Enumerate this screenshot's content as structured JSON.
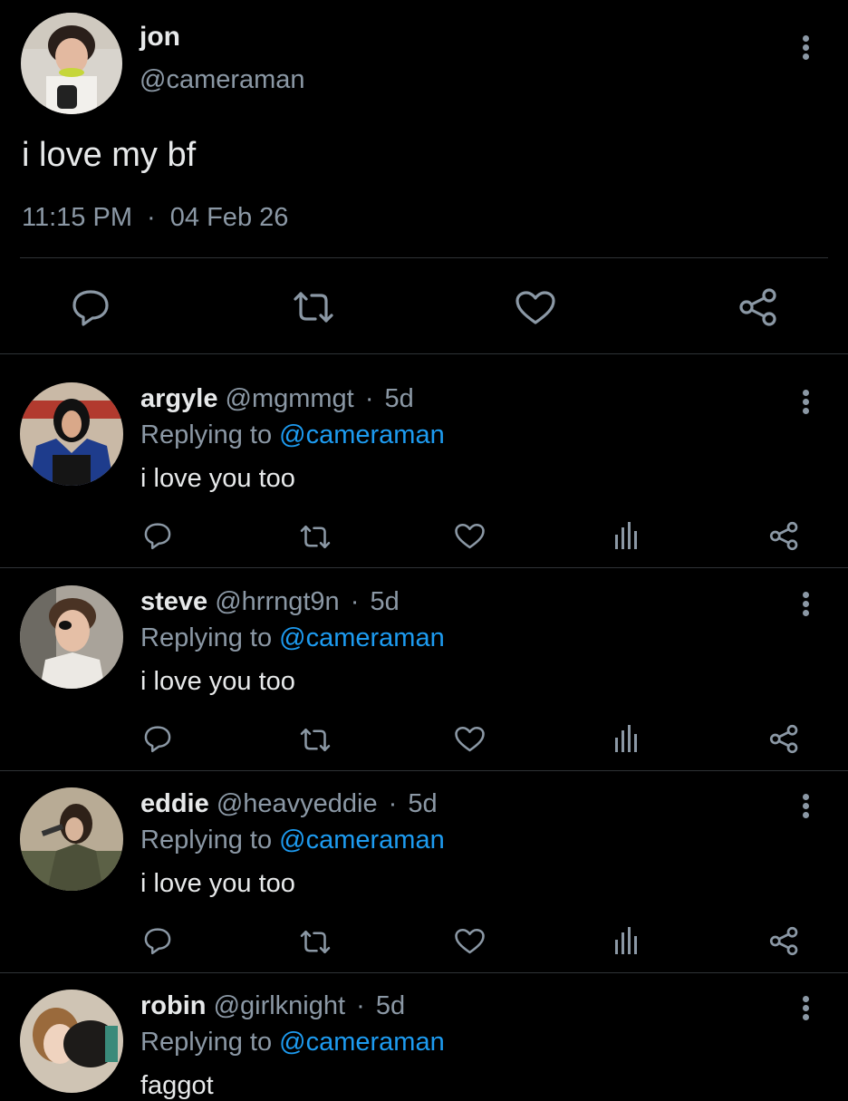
{
  "main_tweet": {
    "display_name": "jon",
    "handle": "@cameraman",
    "text": "i love my bf",
    "time": "11:15 PM",
    "sep": "·",
    "date": "04 Feb 26"
  },
  "replies": [
    {
      "display_name": "argyle",
      "handle": "@mgmmgt",
      "sep": "·",
      "age": "5d",
      "replying_prefix": "Replying to",
      "replying_to": "@cameraman",
      "text": "i love you too"
    },
    {
      "display_name": "steve",
      "handle": "@hrrngt9n",
      "sep": "·",
      "age": "5d",
      "replying_prefix": "Replying to",
      "replying_to": "@cameraman",
      "text": "i love you too"
    },
    {
      "display_name": "eddie",
      "handle": "@heavyeddie",
      "sep": "·",
      "age": "5d",
      "replying_prefix": "Replying to",
      "replying_to": "@cameraman",
      "text": "i love you too"
    },
    {
      "display_name": "robin",
      "handle": "@girlknight",
      "sep": "·",
      "age": "5d",
      "replying_prefix": "Replying to",
      "replying_to": "@cameraman",
      "text": "faggot"
    }
  ],
  "icons": {
    "reply": "reply-icon",
    "retweet": "retweet-icon",
    "like": "heart-icon",
    "views": "views-icon",
    "share": "share-icon",
    "more": "more-vertical-icon"
  },
  "colors": {
    "background": "#000000",
    "text": "#e7e9ea",
    "secondary": "#8b98a5",
    "link": "#1d9bf0",
    "divider": "#2f3336"
  }
}
